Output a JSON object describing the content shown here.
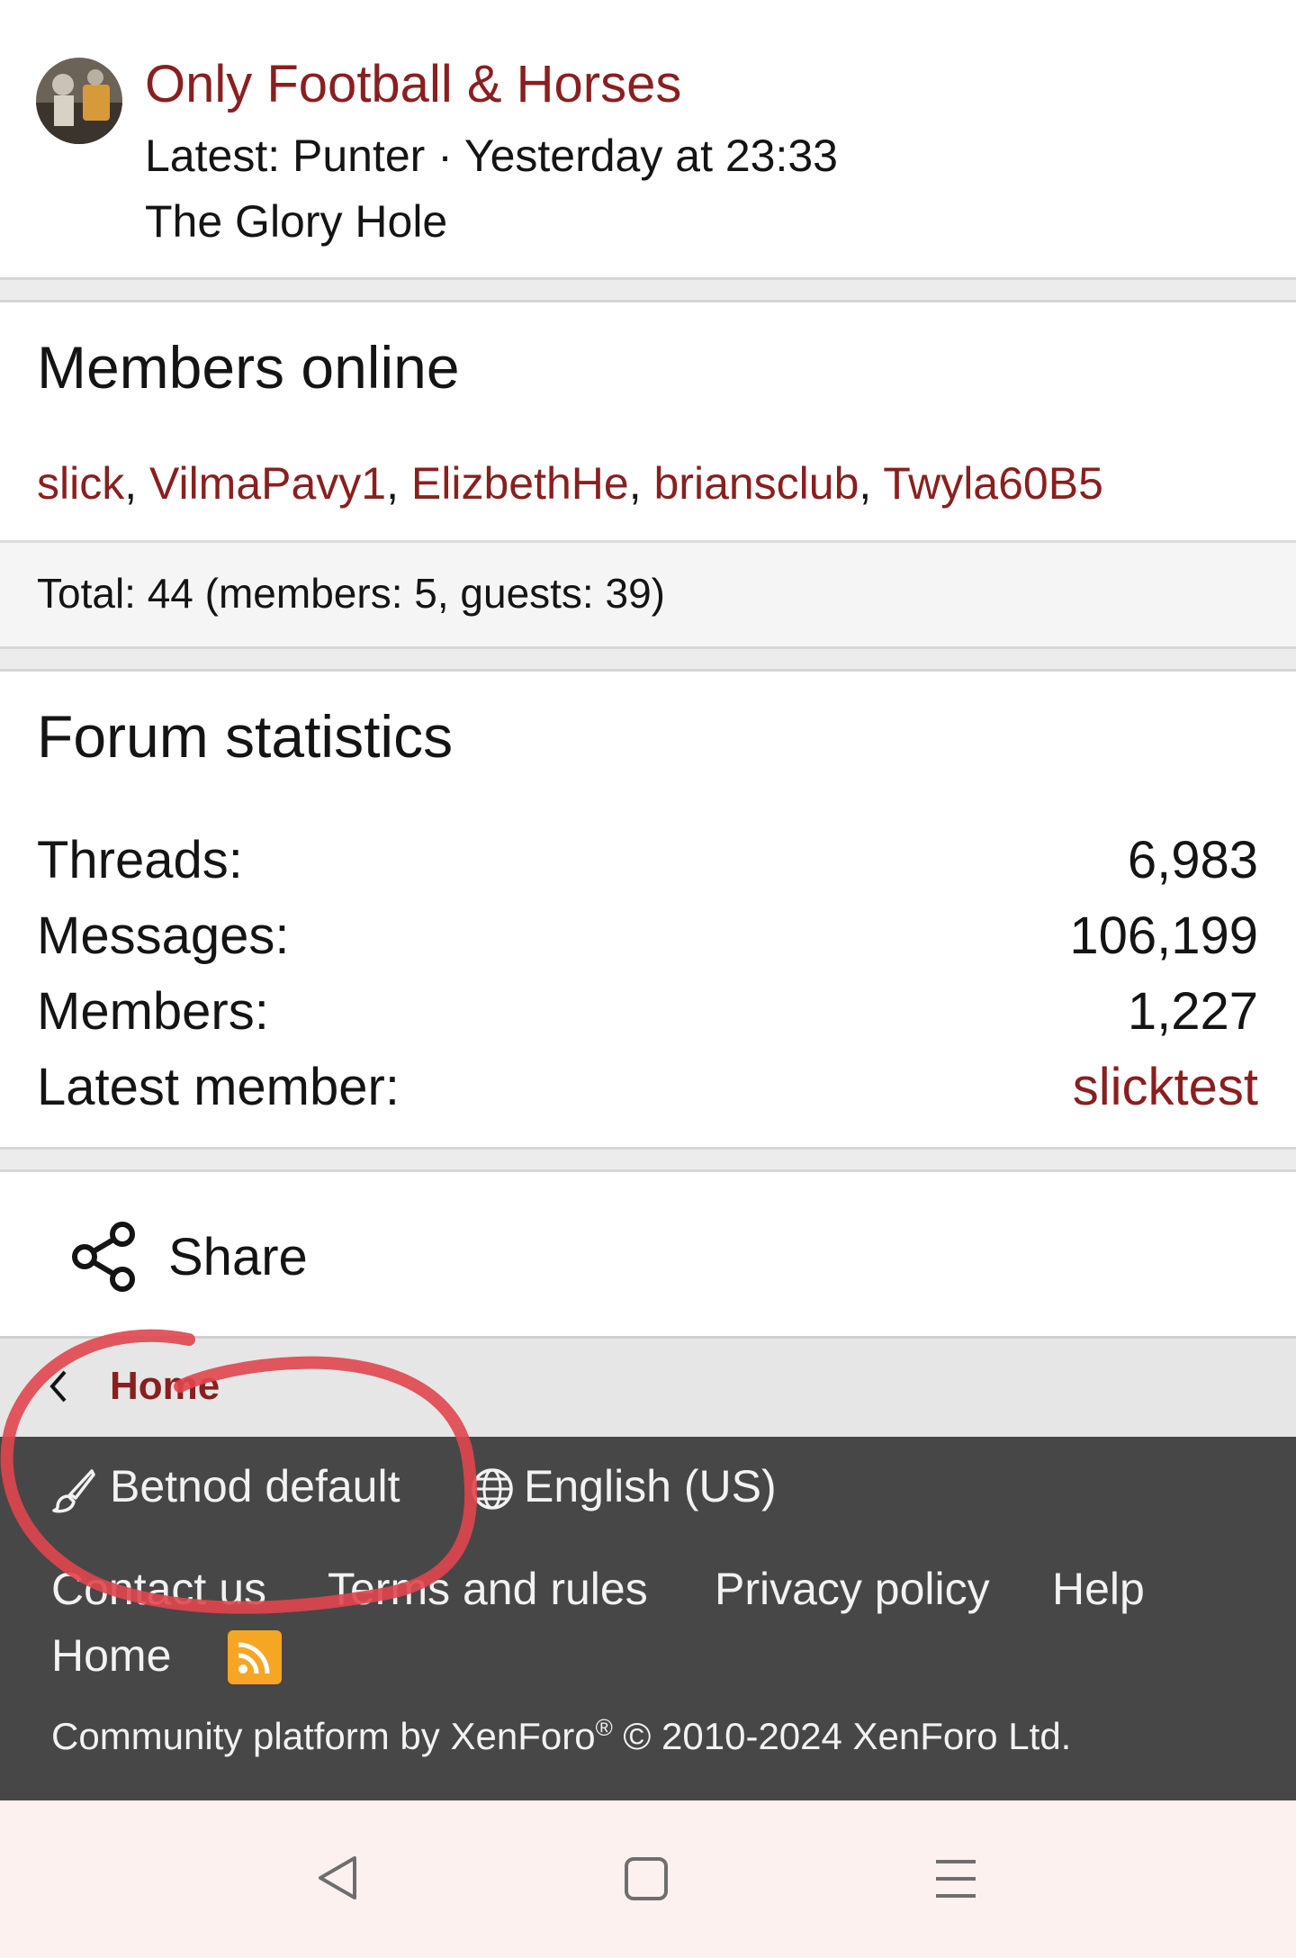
{
  "latest_thread": {
    "title": "Only Football & Horses",
    "latest": "Latest: Punter · Yesterday at 23:33",
    "forum": "The Glory Hole"
  },
  "members_online": {
    "heading": "Members online",
    "users": [
      "slick",
      "VilmaPavy1",
      "ElizbethHe",
      "briansclub",
      "Twyla60B5"
    ],
    "total": "Total: 44 (members: 5, guests: 39)"
  },
  "forum_statistics": {
    "heading": "Forum statistics",
    "rows": [
      {
        "label": "Threads:",
        "value": "6,983"
      },
      {
        "label": "Messages:",
        "value": "106,199"
      },
      {
        "label": "Members:",
        "value": "1,227"
      },
      {
        "label": "Latest member:",
        "value": "slicktest"
      }
    ]
  },
  "share": {
    "label": "Share"
  },
  "breadcrumb": {
    "home": "Home"
  },
  "footer": {
    "style_label": "Betnod default",
    "language_label": "English (US)",
    "links": [
      "Contact us",
      "Terms and rules",
      "Privacy policy",
      "Help",
      "Home"
    ],
    "copyright_prefix": "Community platform by XenForo",
    "copyright_reg": "®",
    "copyright_suffix": " © 2010-2024 XenForo Ltd."
  },
  "colors": {
    "link": "#8a1f1f",
    "footer_bg": "#474747",
    "rss": "#f5a623",
    "annotation": "#e0454c"
  },
  "icons": {
    "share": "share-icon",
    "style": "paintbrush-icon",
    "language": "globe-icon",
    "rss": "rss-icon",
    "back": "chevron-left-icon",
    "nav_back": "triangle-back-icon",
    "nav_home": "square-home-icon",
    "nav_menu": "menu-lines-icon"
  }
}
